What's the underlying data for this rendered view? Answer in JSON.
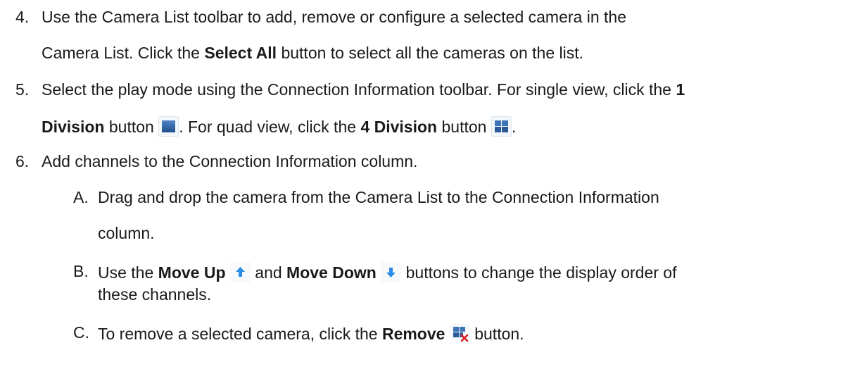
{
  "steps": [
    {
      "number": "4.",
      "line1": "Use the Camera List toolbar to add, remove or configure a selected camera in the",
      "line2_a": "Camera List. Click the ",
      "line2_bold": "Select All",
      "line2_b": " button to select all the cameras on the list."
    },
    {
      "number": "5.",
      "line1_a": "Select the play mode using the Connection Information toolbar. For single view, click the ",
      "line1_bold": "1",
      "line2_bold1": "Division",
      "line2_a": " button ",
      "line2_b": ". For quad view, click the ",
      "line2_bold2": "4 Division",
      "line2_c": " button ",
      "line2_d": "."
    },
    {
      "number": "6.",
      "text": "Add channels to the Connection Information column."
    }
  ],
  "substeps": [
    {
      "letter": "A.",
      "line1": "Drag and drop the camera from the Camera List to the Connection Information",
      "line2": "column."
    },
    {
      "letter": "B.",
      "line1_a": "Use the ",
      "line1_bold1": "Move Up",
      "line1_b": " and ",
      "line1_bold2": "Move Down",
      "line1_c": " buttons to change the display order of",
      "line2": "these channels."
    },
    {
      "letter": "C.",
      "text_a": "To remove a selected camera, click the ",
      "text_bold": "Remove",
      "text_b": " button."
    }
  ],
  "icons": {
    "one_division": "one-division-icon",
    "four_division": "four-division-icon",
    "move_up": "move-up-icon",
    "move_down": "move-down-icon",
    "remove": "remove-icon"
  },
  "colors": {
    "text": "#1a1a1a",
    "icon_blue": "#2f62a6",
    "arrow_blue": "#2b8de8",
    "remove_red": "#e02020"
  }
}
